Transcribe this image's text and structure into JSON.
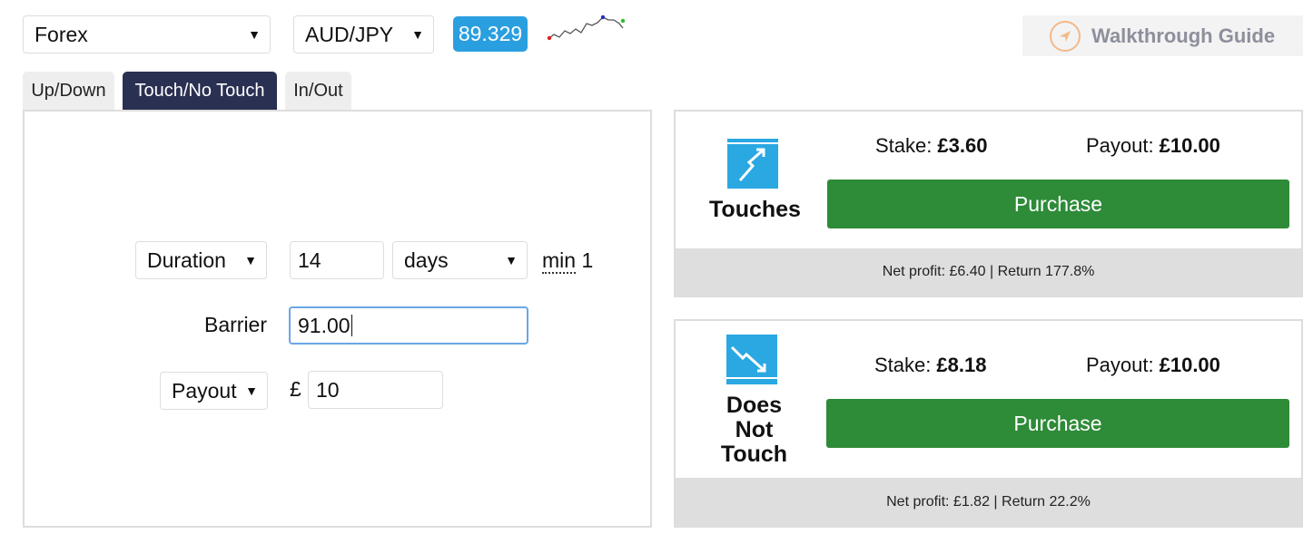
{
  "toolbar": {
    "market": "Forex",
    "symbol": "AUD/JPY",
    "spot": "89.329",
    "walkthrough_label": "Walkthrough Guide"
  },
  "tabs": [
    {
      "label": "Up/Down",
      "active": false
    },
    {
      "label": "Touch/No Touch",
      "active": true
    },
    {
      "label": "In/Out",
      "active": false
    }
  ],
  "form": {
    "duration_type": "Duration",
    "duration_amount": "14",
    "duration_unit": "days",
    "min_abbr": "min",
    "min_value": "1",
    "barrier_label": "Barrier",
    "barrier_value": "91.00",
    "payout_type": "Payout",
    "currency_symbol": "£",
    "payout_amount": "10"
  },
  "contracts": [
    {
      "name": "Touches",
      "stake_label": "Stake:",
      "stake": "£3.60",
      "payout_label": "Payout:",
      "payout": "£10.00",
      "button": "Purchase",
      "footer": "Net profit: £6.40 | Return 177.8%"
    },
    {
      "name_lines": [
        "Does",
        "Not",
        "Touch"
      ],
      "stake_label": "Stake:",
      "stake": "£8.18",
      "payout_label": "Payout:",
      "payout": "£10.00",
      "button": "Purchase",
      "footer": "Net profit: £1.82 | Return 22.2%"
    }
  ],
  "colors": {
    "accent_blue": "#2a9fe0",
    "tab_active": "#2a3052",
    "purchase_green": "#2e8b38"
  },
  "icons": [
    "caret-down-icon",
    "sparkline-icon",
    "compass-icon",
    "touch-up-icon",
    "touch-down-icon"
  ]
}
